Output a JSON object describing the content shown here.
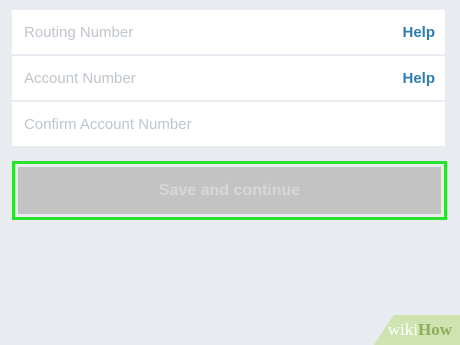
{
  "form": {
    "routing": {
      "placeholder": "Routing Number",
      "help_label": "Help"
    },
    "account": {
      "placeholder": "Account Number",
      "help_label": "Help"
    },
    "confirm_account": {
      "placeholder": "Confirm Account Number"
    },
    "save_button_label": "Save and continue"
  },
  "watermark": {
    "wiki": "wiki",
    "how": "How"
  },
  "colors": {
    "background": "#e8ecf0",
    "field_background": "#ffffff",
    "placeholder_text": "#bfc5cc",
    "help_link": "#2e7cb4",
    "save_button_disabled": "#c3c3c3",
    "highlight_border": "#29e02a"
  }
}
